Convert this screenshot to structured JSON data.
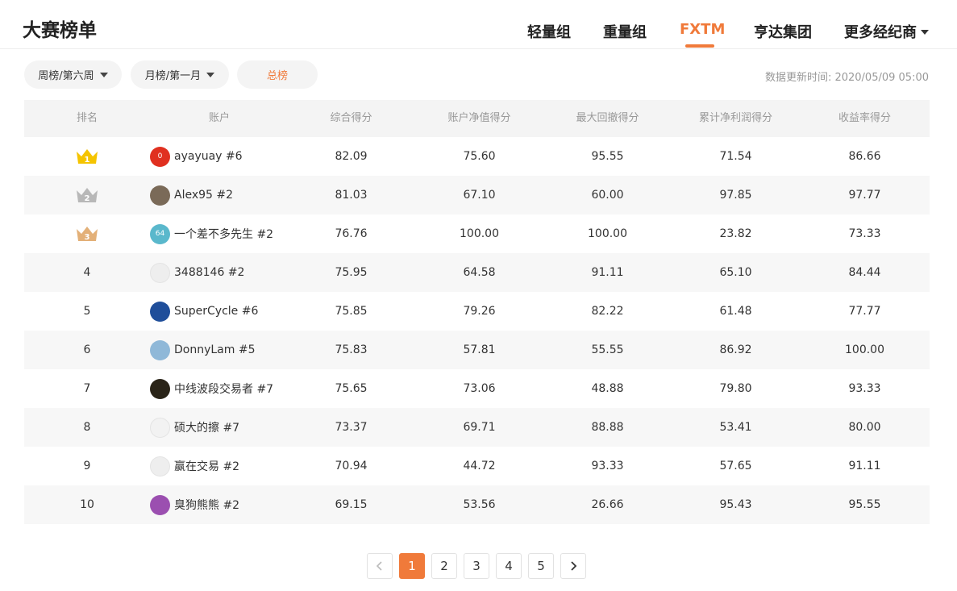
{
  "page_title": "大赛榜单",
  "nav_tabs": [
    {
      "label": "轻量组",
      "active": false
    },
    {
      "label": "重量组",
      "active": false
    },
    {
      "label": "FXTM",
      "active": true
    },
    {
      "label": "亨达集团",
      "active": false
    },
    {
      "label": "更多经纪商",
      "active": false,
      "has_dropdown": true
    }
  ],
  "filters": {
    "weekly": "周榜/第六周",
    "monthly": "月榜/第一月",
    "total": "总榜"
  },
  "update_time": "数据更新时间: 2020/05/09 05:00",
  "table": {
    "columns": [
      "排名",
      "账户",
      "综合得分",
      "账户净值得分",
      "最大回撤得分",
      "累计净利润得分",
      "收益率得分"
    ],
    "rows": [
      {
        "rank": "1",
        "account": "ayayuay #6",
        "avatar_text": "0",
        "total": "82.09",
        "equity": "75.60",
        "drawdown": "95.55",
        "profit": "71.54",
        "return": "86.66"
      },
      {
        "rank": "2",
        "account": "Alex95 #2",
        "avatar_text": "",
        "total": "81.03",
        "equity": "67.10",
        "drawdown": "60.00",
        "profit": "97.85",
        "return": "97.77"
      },
      {
        "rank": "3",
        "account": "一个差不多先生 #2",
        "avatar_text": "64",
        "total": "76.76",
        "equity": "100.00",
        "drawdown": "100.00",
        "profit": "23.82",
        "return": "73.33"
      },
      {
        "rank": "4",
        "account": "3488146 #2",
        "avatar_text": "",
        "total": "75.95",
        "equity": "64.58",
        "drawdown": "91.11",
        "profit": "65.10",
        "return": "84.44"
      },
      {
        "rank": "5",
        "account": "SuperCycle #6",
        "avatar_text": "",
        "total": "75.85",
        "equity": "79.26",
        "drawdown": "82.22",
        "profit": "61.48",
        "return": "77.77"
      },
      {
        "rank": "6",
        "account": "DonnyLam #5",
        "avatar_text": "",
        "total": "75.83",
        "equity": "57.81",
        "drawdown": "55.55",
        "profit": "86.92",
        "return": "100.00"
      },
      {
        "rank": "7",
        "account": "中线波段交易者 #7",
        "avatar_text": "",
        "total": "75.65",
        "equity": "73.06",
        "drawdown": "48.88",
        "profit": "79.80",
        "return": "93.33"
      },
      {
        "rank": "8",
        "account": "硕大的擦 #7",
        "avatar_text": "",
        "total": "73.37",
        "equity": "69.71",
        "drawdown": "88.88",
        "profit": "53.41",
        "return": "80.00"
      },
      {
        "rank": "9",
        "account": "赢在交易 #2",
        "avatar_text": "",
        "total": "70.94",
        "equity": "44.72",
        "drawdown": "93.33",
        "profit": "57.65",
        "return": "91.11"
      },
      {
        "rank": "10",
        "account": "臭狗熊熊 #2",
        "avatar_text": "",
        "total": "69.15",
        "equity": "53.56",
        "drawdown": "26.66",
        "profit": "95.43",
        "return": "95.55"
      }
    ]
  },
  "pagination": {
    "pages": [
      "1",
      "2",
      "3",
      "4",
      "5"
    ],
    "current": "1"
  },
  "colors": {
    "accent": "#f07a3a",
    "gold": "#f5c400",
    "silver": "#b8b8b8",
    "bronze": "#e3b078"
  }
}
